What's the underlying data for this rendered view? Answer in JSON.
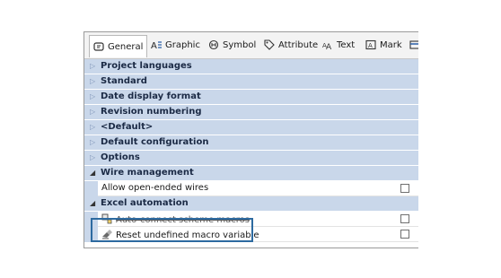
{
  "tabs": [
    {
      "label": "General",
      "icon": "general-icon",
      "active": true
    },
    {
      "label": "Graphic",
      "icon": "graphic-icon"
    },
    {
      "label": "Symbol",
      "icon": "symbol-icon"
    },
    {
      "label": "Attribute",
      "icon": "attribute-icon"
    },
    {
      "label": "Text",
      "icon": "text-icon"
    },
    {
      "label": "Mark",
      "icon": "mark-icon"
    }
  ],
  "categories": {
    "project_languages": "Project languages",
    "standard": "Standard",
    "date_display_format": "Date display format",
    "revision_numbering": "Revision numbering",
    "default": "<Default>",
    "default_configuration": "Default configuration",
    "options": "Options",
    "wire_management": "Wire management",
    "excel_automation": "Excel automation"
  },
  "properties": {
    "allow_open_ended_wires": "Allow open-ended wires",
    "auto_connect_scheme_macros": "Auto-connect scheme macros",
    "reset_undefined_macro_variable": "Reset undefined macro variable"
  },
  "colors": {
    "category_bg": "#c9d7ea",
    "highlight": "#2d6aa0"
  }
}
